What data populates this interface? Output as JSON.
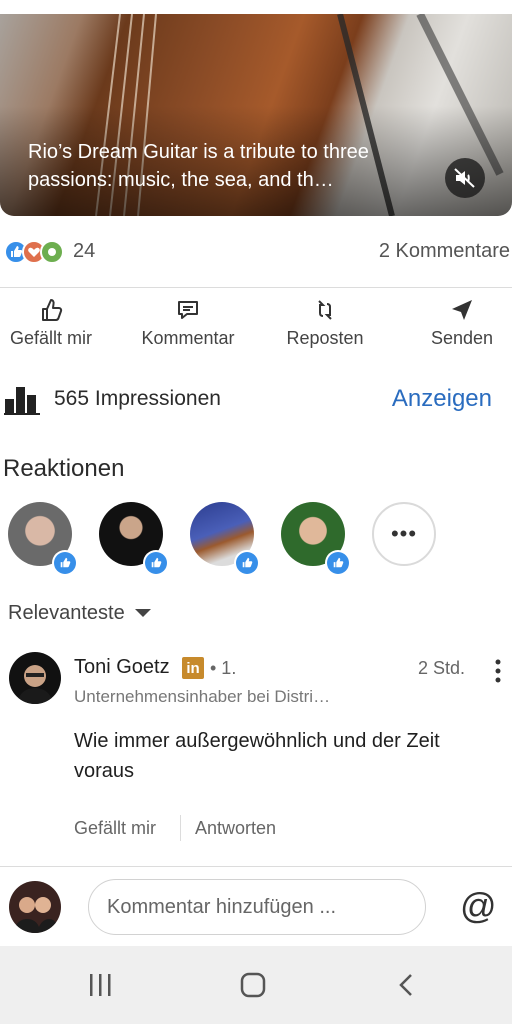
{
  "post": {
    "video_caption": "Rio’s Dream Guitar is a tribute to three passions: music, the sea, and th…",
    "mute_icon": "speaker-muted-icon"
  },
  "social": {
    "reaction_count": "24",
    "comments_count": "2 Kommentare",
    "reaction_icons": [
      "like-icon",
      "love-icon",
      "support-icon"
    ]
  },
  "actions": {
    "like": "Gefällt mir",
    "comment": "Kommentar",
    "repost": "Reposten",
    "send": "Senden"
  },
  "impressions": {
    "text": "565 Impressionen",
    "link": "Anzeigen"
  },
  "reactions": {
    "title": "Reaktionen",
    "more": "•••"
  },
  "sort": {
    "label": "Relevanteste"
  },
  "comment": {
    "author": "Toni Goetz",
    "badge": "in",
    "degree": "• 1.",
    "time": "2 Std.",
    "headline": "Unternehmensinhaber bei Distri…",
    "text": "Wie immer außergewöhnlich und der Zeit voraus",
    "like": "Gefällt mir",
    "reply": "Antworten"
  },
  "compose": {
    "placeholder": "Kommentar hinzufügen ...",
    "mention": "@"
  },
  "colors": {
    "accent": "#2a6cbf",
    "like_blue": "#378fe9",
    "linkedin_badge": "#c78a2c"
  }
}
